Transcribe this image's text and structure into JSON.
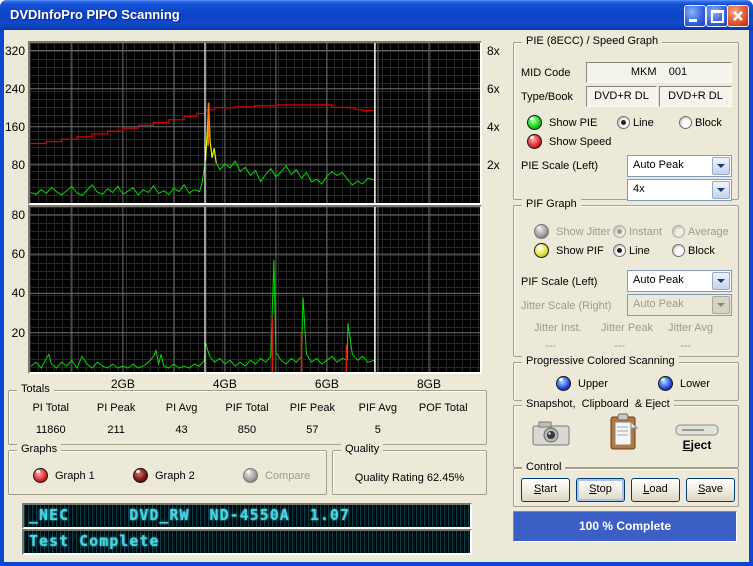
{
  "window": {
    "title": "DVDInfoPro PIPO Scanning"
  },
  "totals": {
    "title": "Totals",
    "columns": [
      {
        "label": "PI Total",
        "value": "11860"
      },
      {
        "label": "PI Peak",
        "value": "211"
      },
      {
        "label": "PI Avg",
        "value": "43"
      },
      {
        "label": "PIF Total",
        "value": "850"
      },
      {
        "label": "PIF Peak",
        "value": "57"
      },
      {
        "label": "PIF Avg",
        "value": "5"
      },
      {
        "label": "POF Total",
        "value": ""
      }
    ]
  },
  "graphs_box": {
    "title": "Graphs",
    "graph1": "Graph 1",
    "graph2": "Graph 2",
    "compare": "Compare"
  },
  "quality_box": {
    "title": "Quality",
    "rating": "Quality Rating 62.45%"
  },
  "lcd": {
    "line1": "_NEC      DVD_RW  ND-4550A  1.07",
    "line2": "Test Complete"
  },
  "pie_box": {
    "title": "PIE (8ECC) / Speed Graph",
    "mid_label": "MID Code",
    "mid_value": "MKM    001",
    "type_label": "Type/Book",
    "type_value1": "DVD+R DL",
    "type_value2": "DVD+R DL",
    "show_pie": "Show PIE",
    "line": "Line",
    "block": "Block",
    "show_speed": "Show Speed",
    "scale_label": "PIE Scale (Left)",
    "scale_value": "Auto Peak",
    "speed_scale_value": "4x"
  },
  "pif_box": {
    "title": "PIF Graph",
    "show_jitter": "Show Jitter",
    "instant": "Instant",
    "average": "Average",
    "show_pif": "Show PIF",
    "line": "Line",
    "block": "Block",
    "scale_label": "PIF Scale (Left)",
    "scale_value": "Auto Peak",
    "jitter_scale_label": "Jitter Scale (Right)",
    "jitter_scale_value": "Auto Peak",
    "jitter_inst_label": "Jitter Inst.",
    "jitter_peak_label": "Jitter Peak",
    "jitter_avg_label": "Jitter Avg",
    "jitter_inst": "---",
    "jitter_peak": "---",
    "jitter_avg": "---"
  },
  "progressive_box": {
    "title": "Progressive Colored Scanning",
    "upper": "Upper",
    "lower": "Lower"
  },
  "snapshot_box": {
    "title": "Snapshot,  Clipboard  & Eject",
    "eject_key": "E",
    "eject_rest": "ject"
  },
  "control_box": {
    "title": "Control",
    "buttons": [
      {
        "key": "S",
        "rest": "tart"
      },
      {
        "key": "S",
        "rest": "top"
      },
      {
        "key": "L",
        "rest": "oad"
      },
      {
        "key": "S",
        "rest": "ave"
      }
    ]
  },
  "progress": {
    "label": "100 % Complete"
  },
  "colors": {
    "pie_trace": "#00dd00",
    "speed_trace": "#dd0000",
    "spike_yellow": "#e8e800",
    "spike_orange": "#ff7800",
    "pof_bars": "#dd2200",
    "grid_major": "#6e6e6e",
    "progress_fill": "#3b5fc4",
    "lcd_text": "#45d6e6"
  },
  "chart_data": [
    {
      "type": "line",
      "title": "PIE (8ECC) / Speed Graph (top pane)",
      "xlim": [
        0.18,
        9.0
      ],
      "ylim": [
        0,
        336
      ],
      "grid_major_color": "#6e6e6e",
      "yticks": [
        {
          "value": 80,
          "label": "80"
        },
        {
          "value": 160,
          "label": "160"
        },
        {
          "value": 240,
          "label": "240"
        },
        {
          "value": 320,
          "label": "320"
        }
      ],
      "yticks_right": [
        {
          "value": 80,
          "label": "2x"
        },
        {
          "value": 160,
          "label": "4x"
        },
        {
          "value": 240,
          "label": "6x"
        },
        {
          "value": 320,
          "label": "8x"
        }
      ],
      "xticks": [
        {
          "value": 2,
          "label": "2GB"
        },
        {
          "value": 4,
          "label": "4GB"
        },
        {
          "value": 6,
          "label": "6GB"
        },
        {
          "value": 8,
          "label": "8GB"
        }
      ],
      "show_x_labels": false,
      "layer_break_x": 3.61,
      "data_end_x": 6.94,
      "series": [
        {
          "name": "PIE",
          "color": "#00dd00",
          "width": 1,
          "points": [
            [
              0.2,
              22
            ],
            [
              0.3,
              18
            ],
            [
              0.4,
              28
            ],
            [
              0.5,
              20
            ],
            [
              0.6,
              33
            ],
            [
              0.7,
              24
            ],
            [
              0.8,
              17
            ],
            [
              0.9,
              26
            ],
            [
              1.0,
              35
            ],
            [
              1.1,
              21
            ],
            [
              1.2,
              16
            ],
            [
              1.3,
              27
            ],
            [
              1.4,
              38
            ],
            [
              1.5,
              23
            ],
            [
              1.6,
              18
            ],
            [
              1.7,
              30
            ],
            [
              1.8,
              22
            ],
            [
              1.9,
              35
            ],
            [
              2.0,
              19
            ],
            [
              2.1,
              25
            ],
            [
              2.2,
              32
            ],
            [
              2.3,
              17
            ],
            [
              2.4,
              28
            ],
            [
              2.5,
              22
            ],
            [
              2.6,
              36
            ],
            [
              2.7,
              20
            ],
            [
              2.8,
              26
            ],
            [
              2.9,
              18
            ],
            [
              3.0,
              31
            ],
            [
              3.1,
              24
            ],
            [
              3.2,
              38
            ],
            [
              3.3,
              21
            ],
            [
              3.4,
              28
            ],
            [
              3.5,
              24
            ],
            [
              3.55,
              40
            ],
            [
              3.62,
              90
            ],
            [
              3.66,
              160
            ],
            [
              3.68,
              211
            ],
            [
              3.71,
              130
            ],
            [
              3.75,
              95
            ],
            [
              3.79,
              115
            ],
            [
              3.83,
              85
            ],
            [
              3.9,
              70
            ],
            [
              4.0,
              82
            ],
            [
              4.1,
              74
            ],
            [
              4.2,
              88
            ],
            [
              4.3,
              66
            ],
            [
              4.4,
              75
            ],
            [
              4.5,
              58
            ],
            [
              4.6,
              68
            ],
            [
              4.7,
              45
            ],
            [
              4.8,
              60
            ],
            [
              4.9,
              72
            ],
            [
              5.0,
              55
            ],
            [
              5.1,
              65
            ],
            [
              5.2,
              78
            ],
            [
              5.3,
              60
            ],
            [
              5.4,
              70
            ],
            [
              5.5,
              52
            ],
            [
              5.6,
              64
            ],
            [
              5.7,
              44
            ],
            [
              5.8,
              50
            ],
            [
              5.9,
              40
            ],
            [
              6.0,
              56
            ],
            [
              6.1,
              66
            ],
            [
              6.2,
              58
            ],
            [
              6.3,
              64
            ],
            [
              6.4,
              50
            ],
            [
              6.5,
              38
            ],
            [
              6.6,
              46
            ],
            [
              6.7,
              40
            ],
            [
              6.8,
              52
            ],
            [
              6.94,
              48
            ]
          ]
        },
        {
          "name": "Speed",
          "color": "#dd0000",
          "width": 1.2,
          "render": "step",
          "points": [
            [
              0.2,
              125
            ],
            [
              0.5,
              129
            ],
            [
              0.8,
              134
            ],
            [
              1.1,
              139
            ],
            [
              1.4,
              145
            ],
            [
              1.7,
              151
            ],
            [
              2.0,
              157
            ],
            [
              2.3,
              163
            ],
            [
              2.6,
              169
            ],
            [
              2.9,
              175
            ],
            [
              3.2,
              182
            ],
            [
              3.45,
              188
            ],
            [
              3.61,
              196
            ],
            [
              3.8,
              200
            ],
            [
              4.2,
              202
            ],
            [
              4.6,
              204
            ],
            [
              5.0,
              206
            ],
            [
              5.5,
              206
            ],
            [
              6.0,
              206
            ],
            [
              6.1,
              201
            ],
            [
              6.4,
              200
            ],
            [
              6.55,
              196
            ],
            [
              6.7,
              194
            ],
            [
              6.94,
              193
            ]
          ]
        },
        {
          "name": "PIE spike (yellow zone)",
          "color": "#e8e800",
          "width": 1.2,
          "points": [
            [
              3.62,
              90
            ],
            [
              3.66,
              160
            ],
            [
              3.68,
              211
            ],
            [
              3.71,
              130
            ],
            [
              3.75,
              95
            ],
            [
              3.79,
              115
            ],
            [
              3.83,
              85
            ]
          ]
        },
        {
          "name": "PIE spike peak (orange)",
          "color": "#ff7800",
          "width": 1.5,
          "points": [
            [
              3.67,
              120
            ],
            [
              3.68,
              211
            ],
            [
              3.69,
              140
            ]
          ]
        }
      ]
    },
    {
      "type": "line",
      "title": "PIF Graph (bottom pane)",
      "xlim": [
        0.18,
        9.0
      ],
      "ylim": [
        0,
        84
      ],
      "grid_major_color": "#6e6e6e",
      "yticks": [
        {
          "value": 20,
          "label": "20"
        },
        {
          "value": 40,
          "label": "40"
        },
        {
          "value": 60,
          "label": "60"
        },
        {
          "value": 80,
          "label": "80"
        }
      ],
      "yticks_right": [],
      "xticks": [
        {
          "value": 2,
          "label": "2GB"
        },
        {
          "value": 4,
          "label": "4GB"
        },
        {
          "value": 6,
          "label": "6GB"
        },
        {
          "value": 8,
          "label": "8GB"
        }
      ],
      "show_x_labels": true,
      "layer_break_x": 3.61,
      "data_end_x": 6.94,
      "series": [
        {
          "name": "PIF",
          "color": "#00dd00",
          "width": 1,
          "points": [
            [
              0.2,
              3
            ],
            [
              0.3,
              5
            ],
            [
              0.4,
              2
            ],
            [
              0.5,
              7
            ],
            [
              0.55,
              9
            ],
            [
              0.6,
              4
            ],
            [
              0.7,
              2
            ],
            [
              0.8,
              5
            ],
            [
              0.9,
              3
            ],
            [
              1.0,
              6
            ],
            [
              1.1,
              2
            ],
            [
              1.2,
              8
            ],
            [
              1.3,
              4
            ],
            [
              1.4,
              2
            ],
            [
              1.5,
              5
            ],
            [
              1.6,
              3
            ],
            [
              1.7,
              2
            ],
            [
              1.8,
              4
            ],
            [
              1.9,
              2
            ],
            [
              2.0,
              3
            ],
            [
              2.1,
              2
            ],
            [
              2.2,
              4
            ],
            [
              2.3,
              2
            ],
            [
              2.4,
              3
            ],
            [
              2.5,
              5
            ],
            [
              2.6,
              8
            ],
            [
              2.65,
              11
            ],
            [
              2.7,
              4
            ],
            [
              2.75,
              9
            ],
            [
              2.8,
              3
            ],
            [
              2.9,
              2
            ],
            [
              3.0,
              4
            ],
            [
              3.1,
              2
            ],
            [
              3.2,
              3
            ],
            [
              3.3,
              2
            ],
            [
              3.4,
              4
            ],
            [
              3.5,
              3
            ],
            [
              3.6,
              6
            ],
            [
              3.62,
              15
            ],
            [
              3.7,
              8
            ],
            [
              3.8,
              5
            ],
            [
              3.9,
              7
            ],
            [
              4.0,
              4
            ],
            [
              4.1,
              6
            ],
            [
              4.2,
              3
            ],
            [
              4.3,
              5
            ],
            [
              4.4,
              3
            ],
            [
              4.5,
              6
            ],
            [
              4.6,
              4
            ],
            [
              4.7,
              7
            ],
            [
              4.8,
              5
            ],
            [
              4.9,
              8
            ],
            [
              4.96,
              57
            ],
            [
              5.0,
              10
            ],
            [
              5.1,
              6
            ],
            [
              5.2,
              4
            ],
            [
              5.3,
              7
            ],
            [
              5.4,
              5
            ],
            [
              5.5,
              8
            ],
            [
              5.53,
              38
            ],
            [
              5.6,
              9
            ],
            [
              5.7,
              5
            ],
            [
              5.8,
              7
            ],
            [
              5.9,
              4
            ],
            [
              6.0,
              6
            ],
            [
              6.1,
              8
            ],
            [
              6.2,
              5
            ],
            [
              6.3,
              7
            ],
            [
              6.4,
              6
            ],
            [
              6.41,
              25
            ],
            [
              6.5,
              9
            ],
            [
              6.6,
              6
            ],
            [
              6.7,
              8
            ],
            [
              6.8,
              5
            ],
            [
              6.94,
              6
            ]
          ]
        },
        {
          "name": "POF / error markers",
          "color": "#dd2200",
          "width": 1.5,
          "render": "vbars",
          "points": [
            [
              4.93,
              28
            ],
            [
              5.5,
              20
            ],
            [
              6.38,
              14
            ]
          ]
        }
      ]
    }
  ]
}
